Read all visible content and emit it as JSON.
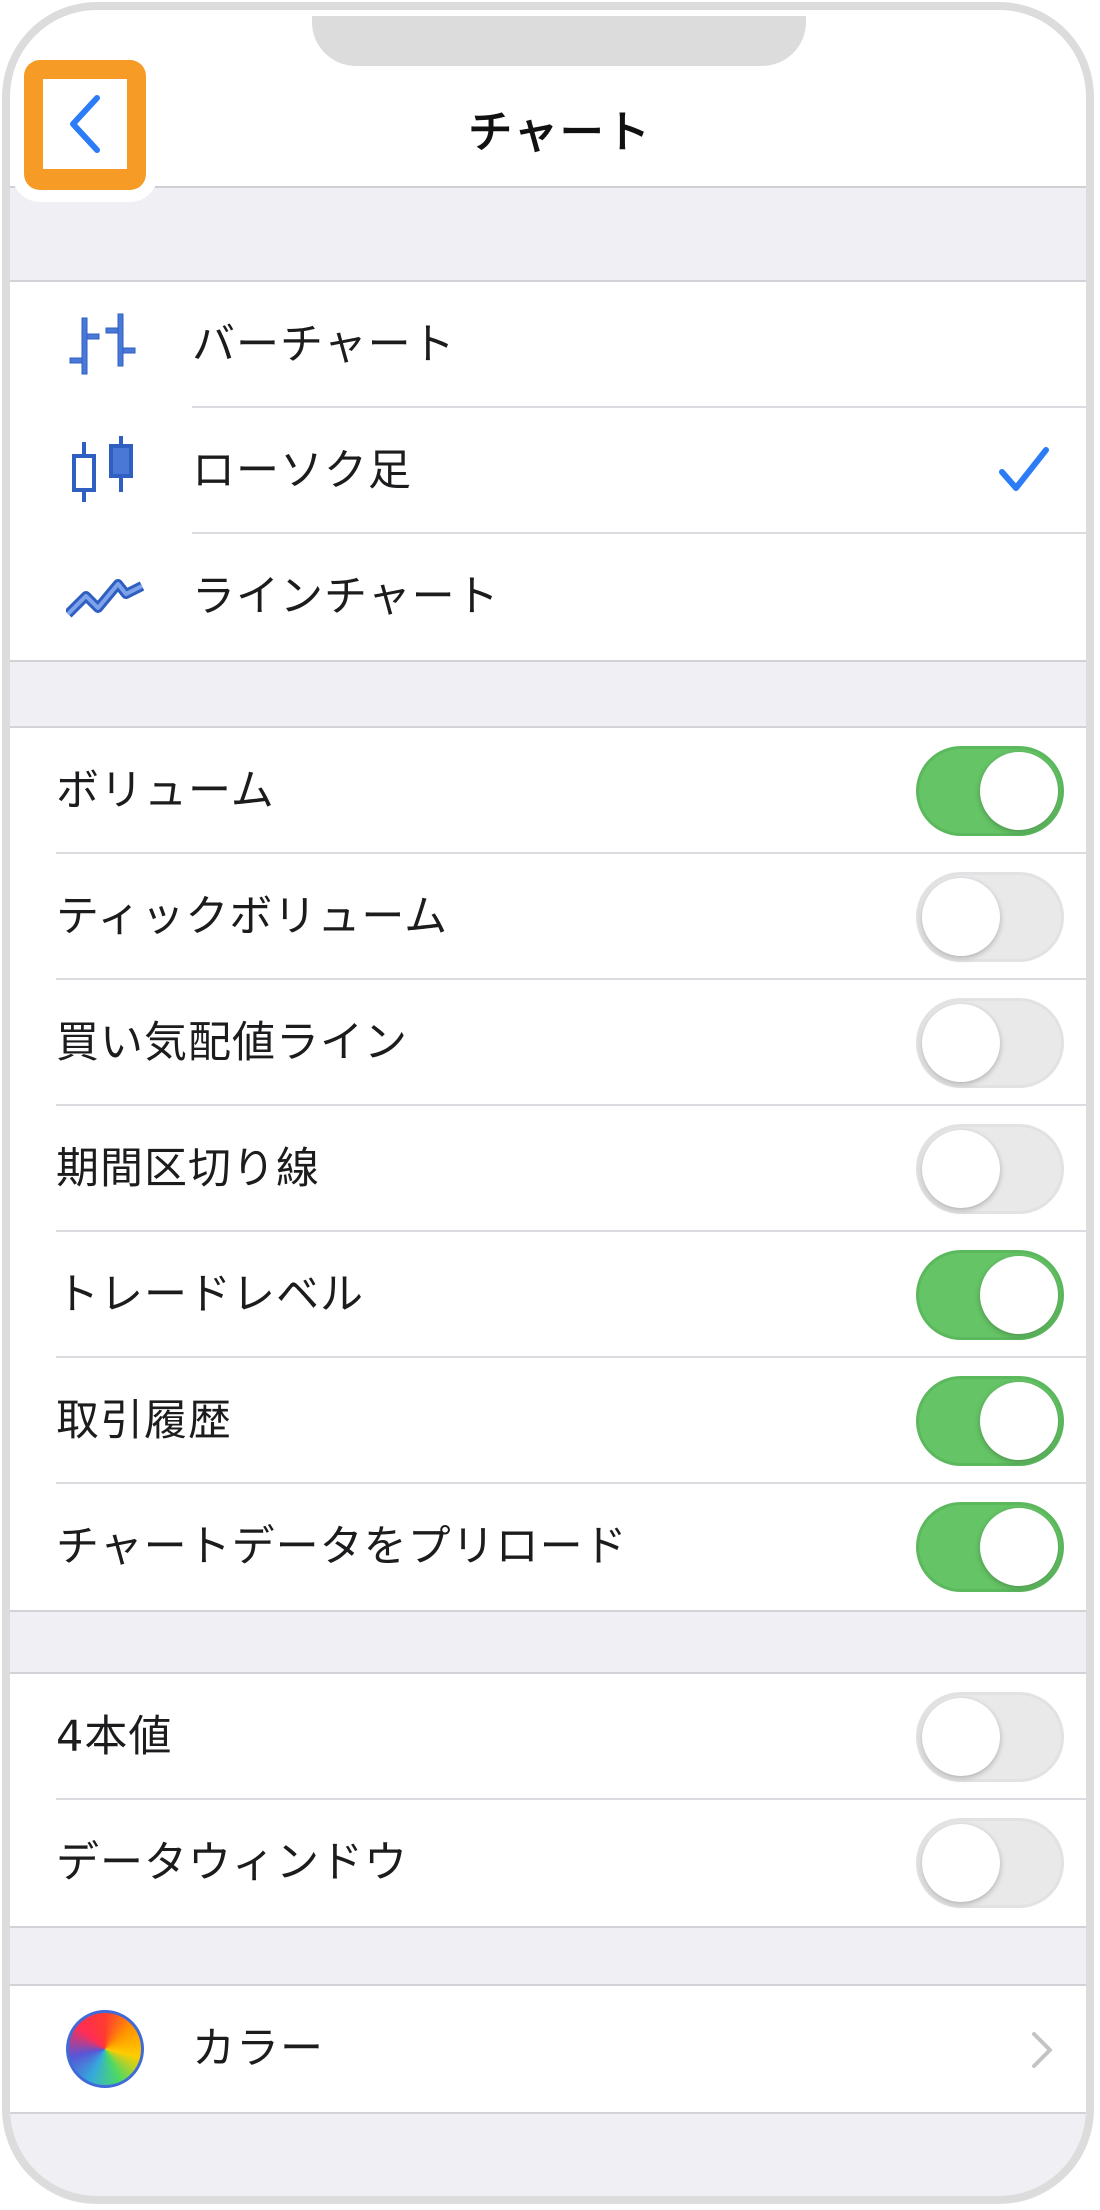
{
  "nav": {
    "title": "チャート",
    "back_icon": "chevron-left-icon"
  },
  "chart_types": [
    {
      "label": "バーチャート",
      "icon": "bar-chart-icon",
      "selected": false
    },
    {
      "label": "ローソク足",
      "icon": "candlestick-icon",
      "selected": true
    },
    {
      "label": "ラインチャート",
      "icon": "line-chart-icon",
      "selected": false
    }
  ],
  "display_options": [
    {
      "label": "ボリューム",
      "on": true
    },
    {
      "label": "ティックボリューム",
      "on": false
    },
    {
      "label": "買い気配値ライン",
      "on": false
    },
    {
      "label": "期間区切り線",
      "on": false
    },
    {
      "label": "トレードレベル",
      "on": true
    },
    {
      "label": "取引履歴",
      "on": true
    },
    {
      "label": "チャートデータをプリロード",
      "on": true
    }
  ],
  "extra_options": [
    {
      "label": "4本値",
      "on": false
    },
    {
      "label": "データウィンドウ",
      "on": false
    }
  ],
  "color_row": {
    "label": "カラー",
    "icon": "color-wheel-icon"
  },
  "colors": {
    "accent": "#2c7cf6",
    "toggle_on": "#65c466",
    "highlight": "#f59b26",
    "background": "#efeff4"
  }
}
